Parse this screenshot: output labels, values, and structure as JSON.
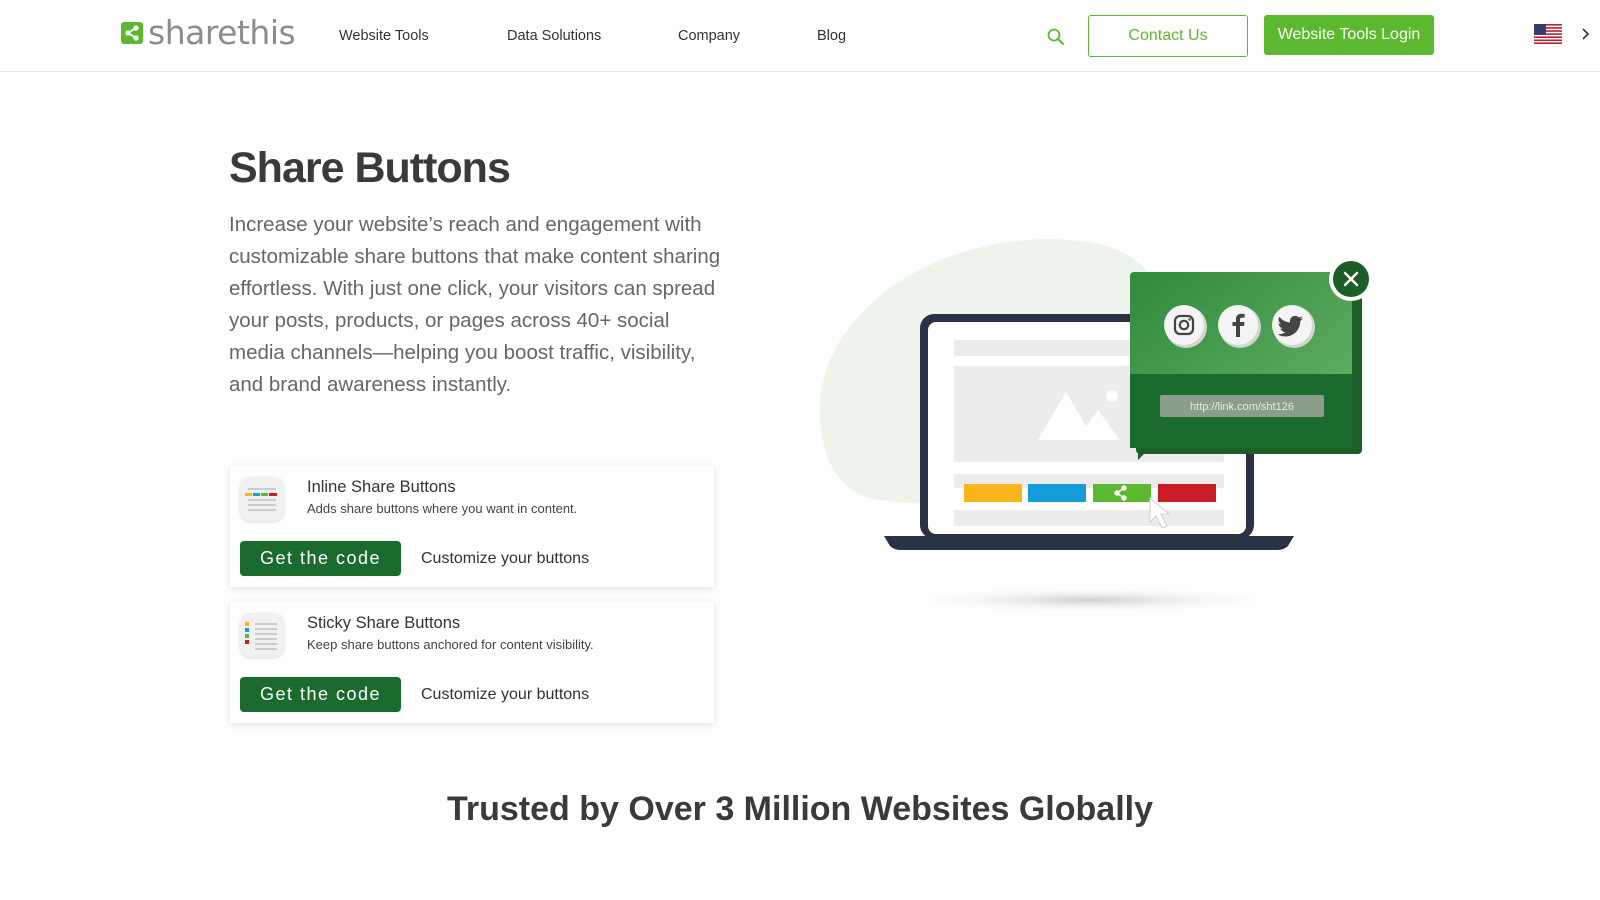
{
  "header": {
    "logo_text": "sharethis",
    "nav": [
      {
        "label": "Website Tools"
      },
      {
        "label": "Data Solutions"
      },
      {
        "label": "Company"
      },
      {
        "label": "Blog"
      }
    ],
    "contact_label": "Contact Us",
    "login_label": "Website Tools Login",
    "language_flag": "us-flag-icon"
  },
  "hero": {
    "title": "Share Buttons",
    "description": "Increase your website’s reach and engagement with customizable share buttons that make content sharing effortless. With just one click, your visitors can spread your posts, products, or pages across 40+ social media channels—helping you boost traffic, visibility, and brand awareness instantly."
  },
  "cards": [
    {
      "title": "Inline Share Buttons",
      "subtitle": "Adds share buttons where you want in content.",
      "code_label": "Get the code",
      "customize_label": "Customize your buttons",
      "icon": "inline-buttons-icon"
    },
    {
      "title": "Sticky Share Buttons",
      "subtitle": "Keep share buttons anchored for content visibility.",
      "code_label": "Get the code",
      "customize_label": "Customize your buttons",
      "icon": "sticky-buttons-icon"
    }
  ],
  "illustration": {
    "link_text": "http://link.com/sht126",
    "social_icons": [
      "instagram-icon",
      "facebook-icon",
      "twitter-icon"
    ]
  },
  "trusted_heading": "Trusted by Over 3 Million Websites Globally",
  "colors": {
    "brand_green": "#5cb82e",
    "dark_green": "#1b6b2e",
    "share_yellow": "#f9b51b",
    "share_blue": "#139ddd",
    "share_red": "#c91c24"
  }
}
